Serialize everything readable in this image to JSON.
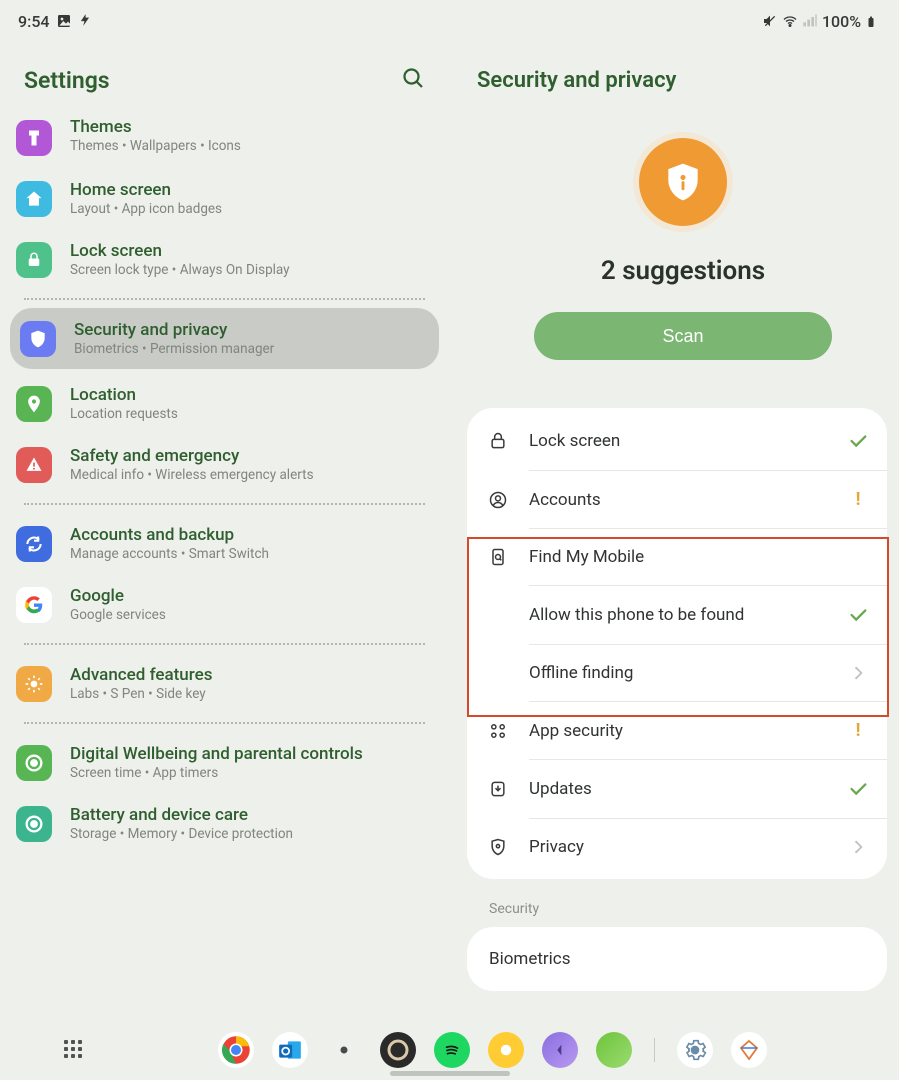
{
  "status": {
    "time": "9:54",
    "battery": "100%"
  },
  "left": {
    "title": "Settings",
    "items": [
      {
        "id": "themes",
        "title": "Themes",
        "sub": "Themes  •  Wallpapers  •  Icons",
        "color": "#b258d6"
      },
      {
        "id": "home-screen",
        "title": "Home screen",
        "sub": "Layout  •  App icon badges",
        "color": "#3fbae0"
      },
      {
        "id": "lock-screen",
        "title": "Lock screen",
        "sub": "Screen lock type  •  Always On Display",
        "color": "#4ec28a"
      },
      {
        "id": "security-privacy",
        "title": "Security and privacy",
        "sub": "Biometrics  •  Permission manager",
        "color": "#6b7cf2",
        "selected": true
      },
      {
        "id": "location",
        "title": "Location",
        "sub": "Location requests",
        "color": "#59b553"
      },
      {
        "id": "safety",
        "title": "Safety and emergency",
        "sub": "Medical info  •  Wireless emergency alerts",
        "color": "#e15c58"
      },
      {
        "id": "accounts-backup",
        "title": "Accounts and backup",
        "sub": "Manage accounts  •  Smart Switch",
        "color": "#3f6de0"
      },
      {
        "id": "google",
        "title": "Google",
        "sub": "Google services",
        "color": "#4285f4"
      },
      {
        "id": "advanced",
        "title": "Advanced features",
        "sub": "Labs  •  S Pen  •  Side key",
        "color": "#f0a945"
      },
      {
        "id": "wellbeing",
        "title": "Digital Wellbeing and parental controls",
        "sub": "Screen time  •  App timers",
        "color": "#58b553"
      },
      {
        "id": "battery",
        "title": "Battery and device care",
        "sub": "Storage  •  Memory  •  Device protection",
        "color": "#3cb58f"
      }
    ],
    "dividers_after": [
      "lock-screen",
      "safety",
      "google",
      "advanced"
    ]
  },
  "right": {
    "title": "Security and privacy",
    "suggestions": "2 suggestions",
    "scan_label": "Scan",
    "rows": [
      {
        "id": "lock-screen",
        "label": "Lock screen",
        "status": "check"
      },
      {
        "id": "accounts",
        "label": "Accounts",
        "status": "warn"
      },
      {
        "id": "find-my-mobile",
        "label": "Find My Mobile",
        "status": ""
      },
      {
        "id": "allow-found",
        "label": "Allow this phone to be found",
        "status": "check",
        "sub": true
      },
      {
        "id": "offline-finding",
        "label": "Offline finding",
        "status": "chev",
        "sub": true
      },
      {
        "id": "app-security",
        "label": "App security",
        "status": "warn"
      },
      {
        "id": "updates",
        "label": "Updates",
        "status": "check"
      },
      {
        "id": "privacy",
        "label": "Privacy",
        "status": "chev"
      }
    ],
    "section_label": "Security",
    "biometrics": "Biometrics"
  }
}
